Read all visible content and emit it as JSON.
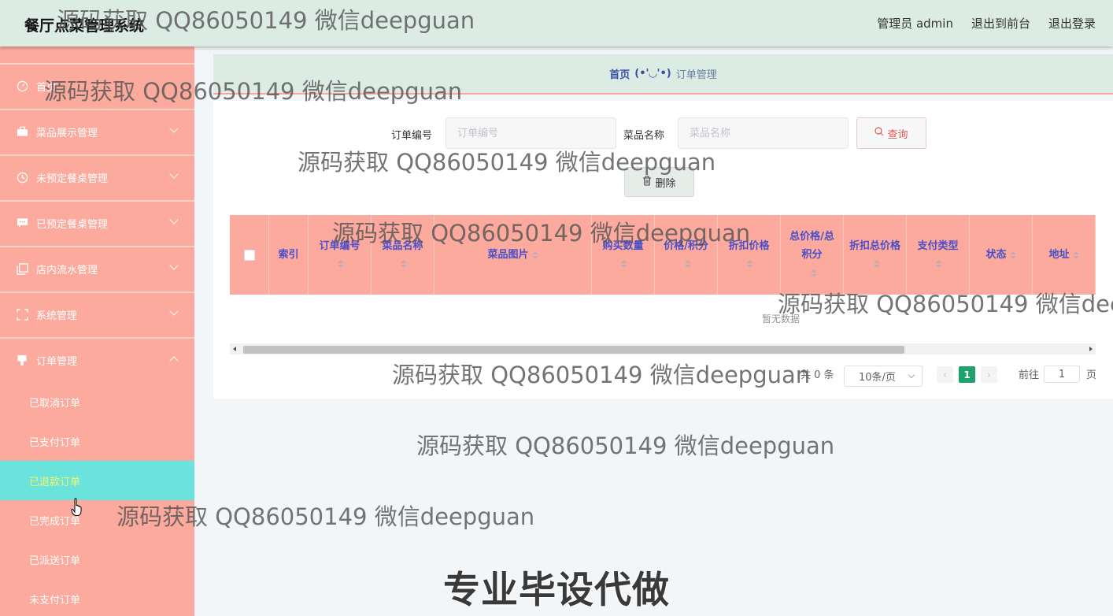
{
  "header": {
    "app_title": "餐厅点菜管理系统",
    "user_label": "管理员 admin",
    "link_frontend": "退出到前台",
    "link_logout": "退出登录"
  },
  "sidebar": {
    "top_item": "首页",
    "items": [
      {
        "label": "菜品展示管理",
        "icon": "briefcase-icon"
      },
      {
        "label": "未预定餐桌管理",
        "icon": "clock-icon"
      },
      {
        "label": "已预定餐桌管理",
        "icon": "chat-icon"
      },
      {
        "label": "店内流水管理",
        "icon": "copy-icon"
      },
      {
        "label": "系统管理",
        "icon": "fullscreen-icon"
      },
      {
        "label": "订单管理",
        "icon": "goods-icon"
      }
    ],
    "sub_items": [
      "已取消订单",
      "已支付订单",
      "已退款订单",
      "已完成订单",
      "已派送订单",
      "未支付订单"
    ],
    "active_sub": "已退款订单"
  },
  "breadcrumb": {
    "home": "首页",
    "separator": "(•'◡'•)",
    "current": "订单管理"
  },
  "search": {
    "order_no_label": "订单编号",
    "order_no_placeholder": "订单编号",
    "dish_name_label": "菜品名称",
    "dish_name_placeholder": "菜品名称",
    "query_button": "查询",
    "delete_button": "删除"
  },
  "table": {
    "columns": [
      {
        "label": "索引",
        "sortable": false
      },
      {
        "label": "订单编号",
        "sortable": true
      },
      {
        "label": "菜品名称",
        "sortable": true
      },
      {
        "label": "菜品图片",
        "sortable": true
      },
      {
        "label": "购买数量",
        "sortable": true
      },
      {
        "label": "价格/积分",
        "sortable": true
      },
      {
        "label": "折扣价格",
        "sortable": true
      },
      {
        "label": "总价格/总积分",
        "sortable": true
      },
      {
        "label": "折扣总价格",
        "sortable": true
      },
      {
        "label": "支付类型",
        "sortable": true
      },
      {
        "label": "状态",
        "sortable": true
      },
      {
        "label": "地址",
        "sortable": true
      }
    ],
    "rows": [],
    "empty_text": "暂无数据"
  },
  "pagination": {
    "total_text": "共 0 条",
    "page_size": "10条/页",
    "current_page": "1",
    "goto_label": "前往",
    "goto_value": "1",
    "page_suffix": "页"
  },
  "watermarks": {
    "text": "源码获取 QQ86050149 微信deepguan",
    "stamp": "专业毕设代做"
  },
  "colors": {
    "header_bg": "#dcebe3",
    "sidebar_bg": "#fcaa9d",
    "active_item_bg": "#6ae3dc",
    "active_item_text": "#f5f56a",
    "table_header_bg": "#fcaa9d",
    "page_active": "#1fa36d"
  }
}
